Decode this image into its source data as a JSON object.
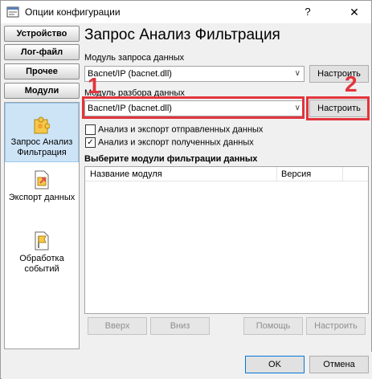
{
  "window": {
    "title": "Опции конфигурации",
    "help_glyph": "?",
    "close_glyph": "✕"
  },
  "nav": {
    "tabs": [
      "Устройство",
      "Лог-файл",
      "Прочее",
      "Модули"
    ],
    "items": [
      {
        "label": "Запрос Анализ Фильтрация",
        "icon": "puzzle-icon",
        "selected": true
      },
      {
        "label": "Экспорт данных",
        "icon": "export-icon",
        "selected": false
      },
      {
        "label": "Обработка событий",
        "icon": "flag-icon",
        "selected": false
      }
    ]
  },
  "main": {
    "title": "Запрос Анализ Фильтрация",
    "query_module_label": "Модуль запроса данных",
    "query_module_value": "Bacnet/IP (bacnet.dll)",
    "parse_module_label": "Модуль разбора данных",
    "parse_module_value": "Bacnet/IP (bacnet.dll)",
    "configure_label": "Настроить",
    "check_sent_label": "Анализ и экспорт отправленных данных",
    "check_sent_checked": false,
    "check_received_label": "Анализ и экспорт полученных данных",
    "check_received_checked": true,
    "filter_section_title": "Выберите модули фильтрации данных",
    "columns": [
      "Название модуля",
      "Версия"
    ],
    "buttons": {
      "up": "Вверх",
      "down": "Вниз",
      "help": "Помощь",
      "configure": "Настроить"
    }
  },
  "annotations": {
    "marker_1": "1",
    "marker_2": "2",
    "color": "#e2353d"
  },
  "footer": {
    "ok": "OK",
    "cancel": "Отмена"
  },
  "colors": {
    "selection": "#cde4f7",
    "window_bg": "#f0f0f0"
  }
}
